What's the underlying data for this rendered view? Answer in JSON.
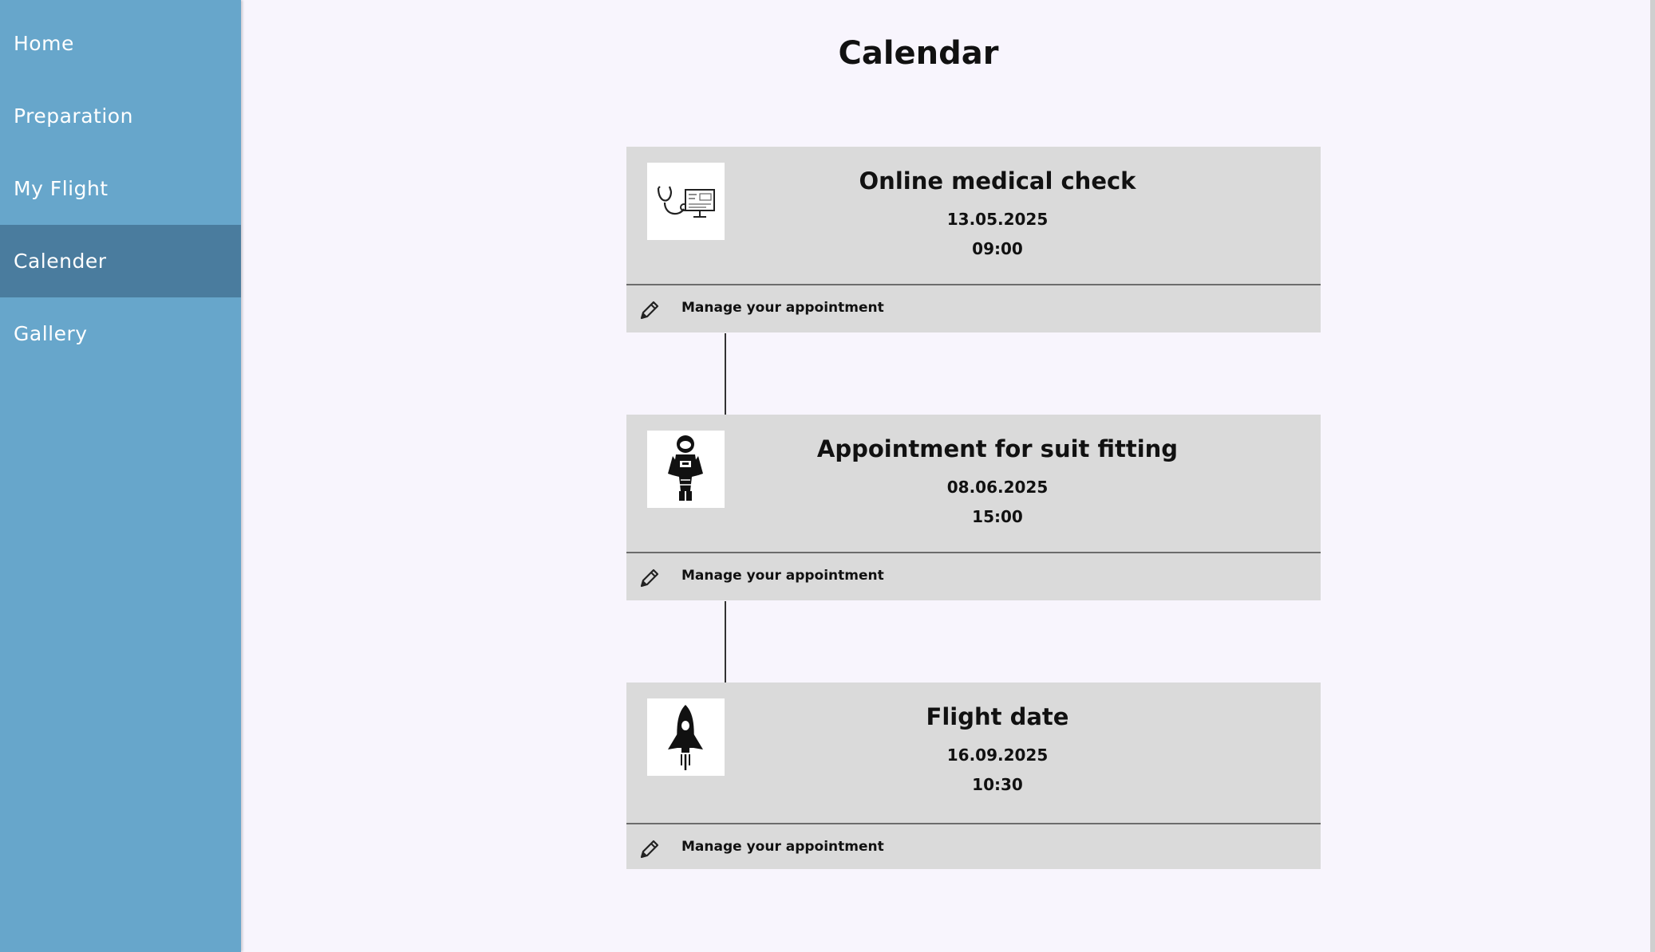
{
  "sidebar": {
    "items": [
      {
        "label": "Home",
        "active": false
      },
      {
        "label": "Preparation",
        "active": false
      },
      {
        "label": "My Flight",
        "active": false
      },
      {
        "label": "Calender",
        "active": true
      },
      {
        "label": "Gallery",
        "active": false
      }
    ]
  },
  "page": {
    "title": "Calendar"
  },
  "appointments": [
    {
      "title": "Online medical check",
      "date": "13.05.2025",
      "time": "09:00",
      "icon": "stethoscope-monitor-icon",
      "action_label": "Manage your appointment"
    },
    {
      "title": "Appointment for suit fitting",
      "date": "08.06.2025",
      "time": "15:00",
      "icon": "astronaut-icon",
      "action_label": "Manage your appointment"
    },
    {
      "title": "Flight date",
      "date": "16.09.2025",
      "time": "10:30",
      "icon": "rocket-icon",
      "action_label": "Manage your appointment"
    }
  ],
  "colors": {
    "sidebar": "#67a6cb",
    "sidebar_active": "#4a7c9e",
    "card": "#dadada",
    "background": "#f8f5fd"
  }
}
